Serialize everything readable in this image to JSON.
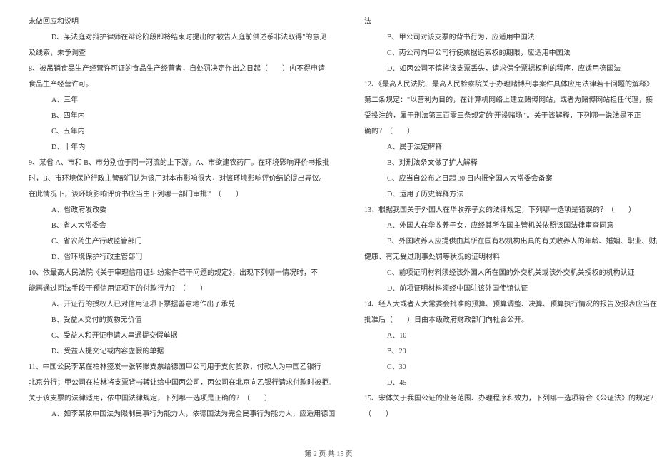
{
  "column_left": [
    {
      "text": "未做回应和说明",
      "indent": 0
    },
    {
      "text": "D、某法庭对辩护律师在辩论阶段即将结束时提出的\"被告人庭前供述系非法取得\"的意见",
      "indent": 1
    },
    {
      "text": "及线索，未予调查",
      "indent": 0
    },
    {
      "text": "8、被吊销食品生产经营许可证的食品生产经营者，自处罚决定作出之日起（　　）内不得申请",
      "indent": 0
    },
    {
      "text": "食品生产经营许可。",
      "indent": 0
    },
    {
      "text": "A、三年",
      "indent": 1
    },
    {
      "text": "B、四年内",
      "indent": 1
    },
    {
      "text": "C、五年内",
      "indent": 1
    },
    {
      "text": "D、十年内",
      "indent": 1
    },
    {
      "text": "9、某省 A、市和 B、市分别位于同一河流的上下游。A、市欲建农药厂。在环境影响评价书报批",
      "indent": 0
    },
    {
      "text": "时，B、市环境保护行政主管部门认为该厂对本市影响很大，对该环境影响评价结论提出异议。",
      "indent": 0
    },
    {
      "text": "在此情况下，该环境影响评价书应当由下列哪一部门审批？（　　）",
      "indent": 0
    },
    {
      "text": "A、省政府发改委",
      "indent": 1
    },
    {
      "text": "B、省人大常委会",
      "indent": 1
    },
    {
      "text": "C、省农药生产行政监管部门",
      "indent": 1
    },
    {
      "text": "D、省环境保护行政主管部门",
      "indent": 1
    },
    {
      "text": "10、依最高人民法院《关于审理信用证纠纷案件若干问题的规定》，出现下列哪一情况时，不",
      "indent": 0
    },
    {
      "text": "能再通过司法手段干预信用证项下的付款行为？（　　）",
      "indent": 0
    },
    {
      "text": "A、开证行的授权人已对信用证项下票据善意地作出了承兑",
      "indent": 1
    },
    {
      "text": "B、受益人交付的货物无价值",
      "indent": 1
    },
    {
      "text": "C、受益人和开证申请人串通提交假单据",
      "indent": 1
    },
    {
      "text": "D、受益人提交记载内容虚假的单据",
      "indent": 1
    },
    {
      "text": "11、中国公民李某在柏林签发一张转账支票给德国甲公司用于支付货款，付款人为中国乙银行",
      "indent": 0
    },
    {
      "text": "北京分行；甲公司在柏林将支票背书转让给中国丙公司，丙公司在北京向乙银行请求付款时被拒。",
      "indent": 0
    },
    {
      "text": "关于该支票的法律适用，依中国法律规定，下列哪一选项是正确的？（　　）",
      "indent": 0
    },
    {
      "text": "A、如李某依中国法为限制民事行为能力人，依德国法为完全民事行为能力人，应适用德国",
      "indent": 1
    }
  ],
  "column_right": [
    {
      "text": "法",
      "indent": 0
    },
    {
      "text": "B、甲公司对该支票的背书行为，应适用中国法",
      "indent": 1
    },
    {
      "text": "C、丙公司向甲公司行使票据追索权的期限，应适用中国法",
      "indent": 1
    },
    {
      "text": "D、如丙公司不慎将该支票丢失，请求保全票据权利的程序，应适用德国法",
      "indent": 1
    },
    {
      "text": "12、《最高人民法院、最高人民检察院关于办理赌博刑事案件具体应用法律若干问题的解释》",
      "indent": 0
    },
    {
      "text": "第二条规定：\"以营利为目的，在计算机网络上建立赌博网站，或者为赌博网站担任代理，接",
      "indent": 0
    },
    {
      "text": "受投注的，属于刑法第三百零三条规定的'开设赌场'\"。关于该解释，下列哪一说法是不正",
      "indent": 0
    },
    {
      "text": "确的？（　　）",
      "indent": 0
    },
    {
      "text": "A、属于法定解释",
      "indent": 1
    },
    {
      "text": "B、对刑法条文做了扩大解释",
      "indent": 1
    },
    {
      "text": "C、应当自公布之日起 30 日内报全国人大常委会备案",
      "indent": 1
    },
    {
      "text": "D、运用了历史解释方法",
      "indent": 1
    },
    {
      "text": "13、根据我国关于外国人在华收养子女的法律规定，下列哪一选项是错误的？（　　）",
      "indent": 0
    },
    {
      "text": "A、外国人在华收养子女，应经其所在国主管机关依照该国法律审查同意",
      "indent": 1
    },
    {
      "text": "B、外国收养人应提供由其所在国有权机构出具的有关收养人的年龄、婚姻、职业、财产、",
      "indent": 1
    },
    {
      "text": "健康、有无受过刑事处罚等状况的证明材料",
      "indent": 0
    },
    {
      "text": "C、前项证明材料须经该外国人所在国的外交机关或该外交机关授权的机构认证",
      "indent": 1
    },
    {
      "text": "D、前项证明材料须经中国驻该外国使馆认证",
      "indent": 1
    },
    {
      "text": "14、经人大或者人大常委会批准的预算、预算调整、决算、预算执行情况的报告及报表应当在",
      "indent": 0
    },
    {
      "text": "批准后（　　）日由本级政府财政部门向社会公开。",
      "indent": 0
    },
    {
      "text": "A、10",
      "indent": 1
    },
    {
      "text": "B、20",
      "indent": 1
    },
    {
      "text": "C、30",
      "indent": 1
    },
    {
      "text": "D、45",
      "indent": 1
    },
    {
      "text": "15、宋体关于我国公证的业务范围、办理程序和效力，下列哪一选项符合《公证法》的规定？",
      "indent": 0
    },
    {
      "text": "（　　）",
      "indent": 0
    }
  ],
  "footer": "第 2 页 共 15 页"
}
